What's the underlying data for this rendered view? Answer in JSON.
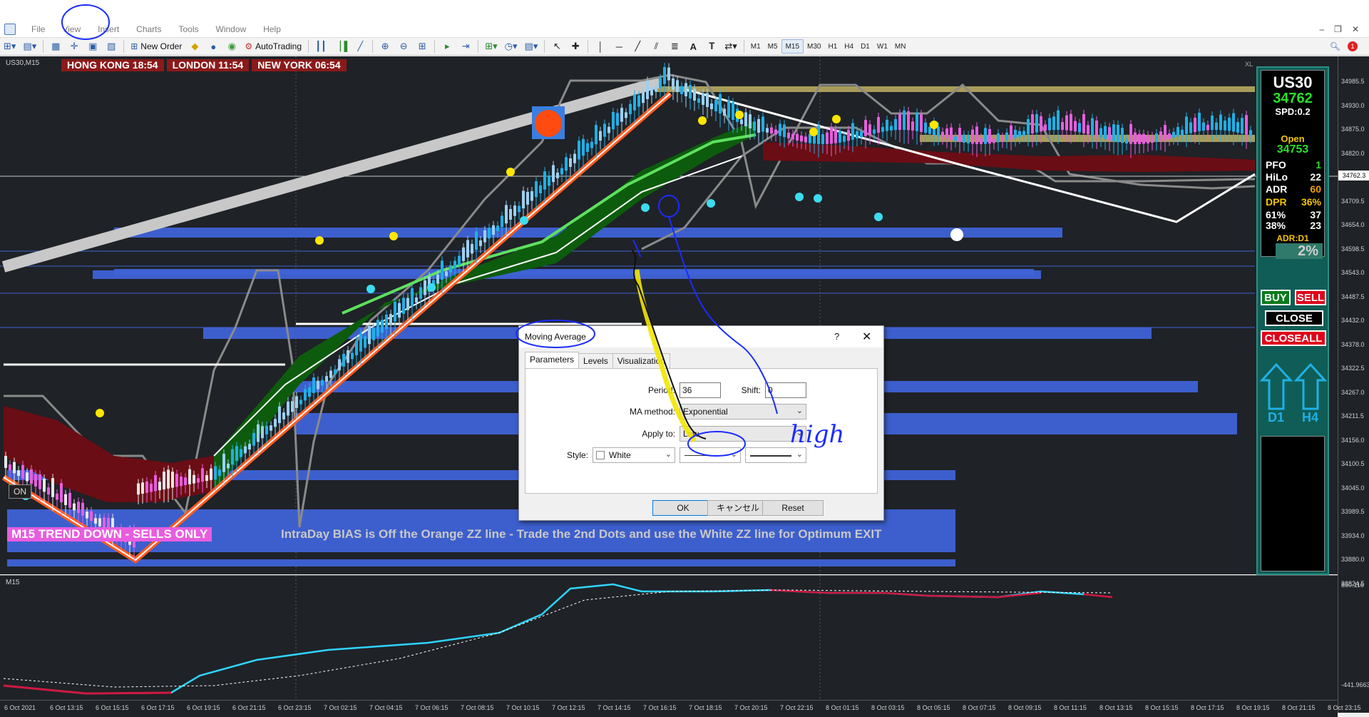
{
  "menu": {
    "items": [
      "File",
      "View",
      "Insert",
      "Charts",
      "Tools",
      "Window",
      "Help"
    ]
  },
  "toolbar": {
    "new_order": "New Order",
    "autotrading": "AutoTrading",
    "timeframes": [
      "M1",
      "M5",
      "M15",
      "M30",
      "H1",
      "H4",
      "D1",
      "W1",
      "MN"
    ],
    "active_timeframe": "M15",
    "notification_count": "1"
  },
  "chart": {
    "symbol_label": "US30,M15",
    "sessions": [
      "HONG KONG 18:54",
      "LONDON  11:54",
      "NEW YORK  06:54"
    ],
    "xl_label": "XL",
    "on_button": "ON",
    "trend_text": "M15  TREND DOWN - SELLS ONLY",
    "bias_text": "IntraDay BIAS is Off the Orange ZZ line - Trade the 2nd Dots and use the White ZZ line for Optimum EXIT",
    "current_price_tag": "34762.3",
    "price_ticks": [
      "34985.5",
      "34930.0",
      "34875.0",
      "34820.0",
      "34765.0",
      "34709.5",
      "34654.0",
      "34598.5",
      "34543.0",
      "34487.5",
      "34432.0",
      "34378.0",
      "34322.5",
      "34267.0",
      "34211.5",
      "34156.0",
      "34100.5",
      "34045.0",
      "33989.5",
      "33934.0",
      "33880.0",
      "33824.5"
    ],
    "colors": {
      "bull": "#1fb0e6",
      "bear": "#e85de0",
      "green_cloud": "#0d5c0d",
      "red_cloud": "#6b0d14",
      "orange_zz": "#ff5a1f",
      "blue_zone": "#3f63d6"
    }
  },
  "panel": {
    "symbol": "US30",
    "price": "34762",
    "spread": "SPD:0.2",
    "open_label": "Open",
    "open_value": "34753",
    "rows": [
      {
        "k": "PFO",
        "v": "1",
        "kc": "#ffffff",
        "vc": "#28e028"
      },
      {
        "k": "HiLo",
        "v": "22",
        "kc": "#ffffff",
        "vc": "#ffffff"
      },
      {
        "k": "ADR",
        "v": "60",
        "kc": "#ffffff",
        "vc": "#f4a000"
      },
      {
        "k": "DPR",
        "v": "36%",
        "kc": "#f4c400",
        "vc": "#f4c400"
      },
      {
        "k": "61%",
        "v": "37",
        "kc": "#ffffff",
        "vc": "#ffffff"
      },
      {
        "k": "38%",
        "v": "23",
        "kc": "#ffffff",
        "vc": "#ffffff"
      }
    ],
    "adr_d1": "ADR:D1",
    "pct": "2%",
    "buy": "BUY",
    "sell": "SELL",
    "close": "CLOSE",
    "closeall": "CLOSEALL",
    "arrow_d1": "D1",
    "arrow_h4": "H4"
  },
  "subwindow": {
    "label": "M15",
    "top_value": "850.116",
    "bottom_value": "-441.9663"
  },
  "time_axis": [
    "6 Oct 2021",
    "6 Oct 13:15",
    "6 Oct 15:15",
    "6 Oct 17:15",
    "6 Oct 19:15",
    "6 Oct 21:15",
    "6 Oct 23:15",
    "7 Oct 02:15",
    "7 Oct 04:15",
    "7 Oct 06:15",
    "7 Oct 08:15",
    "7 Oct 10:15",
    "7 Oct 12:15",
    "7 Oct 14:15",
    "7 Oct 16:15",
    "7 Oct 18:15",
    "7 Oct 20:15",
    "7 Oct 22:15",
    "8 Oct 01:15",
    "8 Oct 03:15",
    "8 Oct 05:15",
    "8 Oct 07:15",
    "8 Oct 09:15",
    "8 Oct 11:15",
    "8 Oct 13:15",
    "8 Oct 15:15",
    "8 Oct 17:15",
    "8 Oct 19:15",
    "8 Oct 21:15",
    "8 Oct 23:15"
  ],
  "dialog": {
    "title": "Moving Average",
    "help": "?",
    "tabs": [
      "Parameters",
      "Levels",
      "Visualization"
    ],
    "period_label": "Period:",
    "period_value": "36",
    "shift_label": "Shift:",
    "shift_value": "0",
    "method_label": "MA method:",
    "method_value": "Exponential",
    "apply_label": "Apply to:",
    "apply_value": "Low",
    "style_label": "Style:",
    "style_color": "White",
    "ok": "OK",
    "cancel": "キャンセル",
    "reset": "Reset"
  },
  "annotation": {
    "handwritten": "high"
  }
}
